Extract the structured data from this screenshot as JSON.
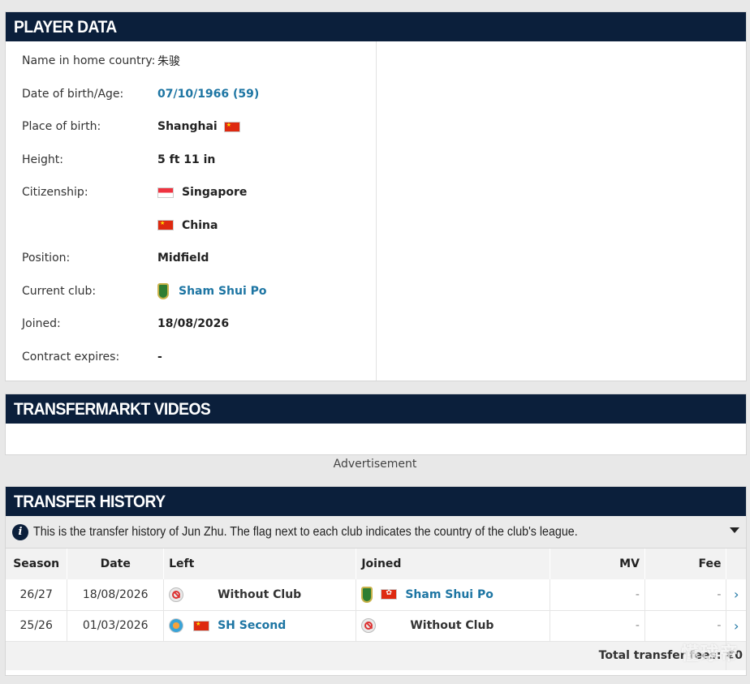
{
  "player_data": {
    "title": "PLAYER DATA",
    "rows": {
      "home_name": {
        "label": "Name in home country:",
        "value": "朱骏"
      },
      "dob": {
        "label": "Date of birth/Age:",
        "value": "07/10/1966 (59)"
      },
      "pob": {
        "label": "Place of birth:",
        "value": "Shanghai"
      },
      "height": {
        "label": "Height:",
        "value": "5 ft 11 in"
      },
      "citizenship": {
        "label": "Citizenship:",
        "value1": "Singapore",
        "value2": "China"
      },
      "position": {
        "label": "Position:",
        "value": "Midfield"
      },
      "club": {
        "label": "Current club:",
        "value": "Sham Shui Po"
      },
      "joined": {
        "label": "Joined:",
        "value": "18/08/2026"
      },
      "contract": {
        "label": "Contract expires:",
        "value": "-"
      }
    }
  },
  "videos": {
    "title": "TRANSFERMARKT VIDEOS"
  },
  "advertisement": "Advertisement",
  "transfer_history": {
    "title": "TRANSFER HISTORY",
    "info": "This is the transfer history of Jun Zhu. The flag next to each club indicates the country of the club's league.",
    "headers": {
      "season": "Season",
      "date": "Date",
      "left": "Left",
      "joined": "Joined",
      "mv": "MV",
      "fee": "Fee"
    },
    "rows": [
      {
        "season": "26/27",
        "date": "18/08/2026",
        "left": "Without Club",
        "joined": "Sham Shui Po",
        "mv": "-",
        "fee": "-"
      },
      {
        "season": "25/26",
        "date": "01/03/2026",
        "left": "SH Second",
        "joined": "Without Club",
        "mv": "-",
        "fee": "-"
      }
    ],
    "total_label": "Total transfer fees:",
    "total_value": "€0"
  },
  "watermark": "懂球帝",
  "colors": {
    "header": "#0b1f3b",
    "link": "#1d75a3"
  },
  "icons": {
    "flag_cn": "china-flag-icon",
    "flag_sg": "singapore-flag-icon",
    "flag_hk": "hong-kong-flag-icon"
  }
}
